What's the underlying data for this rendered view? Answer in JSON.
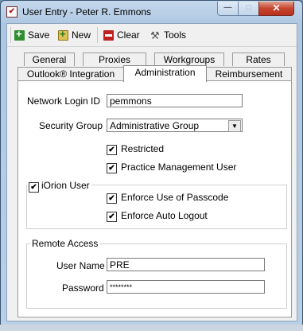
{
  "window": {
    "title": "User Entry - Peter R. Emmons",
    "app_icon": "check-box-icon"
  },
  "titlebar_buttons": {
    "minimize": "—",
    "maximize": "□",
    "close": "✕"
  },
  "toolbar": {
    "save_label": "Save",
    "new_label": "New",
    "clear_label": "Clear",
    "tools_label": "Tools",
    "tools_glyph": "⚒"
  },
  "tabs": {
    "general": "General",
    "proxies": "Proxies",
    "workgroups": "Workgroups",
    "rates": "Rates",
    "outlook": "Outlook® Integration",
    "administration": "Administration",
    "reimbursement": "Reimbursement",
    "active": "Administration"
  },
  "form": {
    "network_login_label": "Network Login ID",
    "network_login_value": "pemmons",
    "security_group_label": "Security Group",
    "security_group_value": "Administrative Group",
    "restricted_label": "Restricted",
    "restricted_checked": true,
    "pm_user_label": "Practice Management User",
    "pm_user_checked": true,
    "iorion_label": "iOrion User",
    "iorion_checked": true,
    "passcode_label": "Enforce Use of Passcode",
    "passcode_checked": true,
    "autologout_label": "Enforce Auto Logout",
    "autologout_checked": true,
    "remote_access_label": "Remote Access",
    "username_label": "User Name",
    "username_value": "PRE",
    "password_label": "Password",
    "password_value": "********"
  },
  "check_glyph": "✔",
  "dropdown_glyph": "▼"
}
